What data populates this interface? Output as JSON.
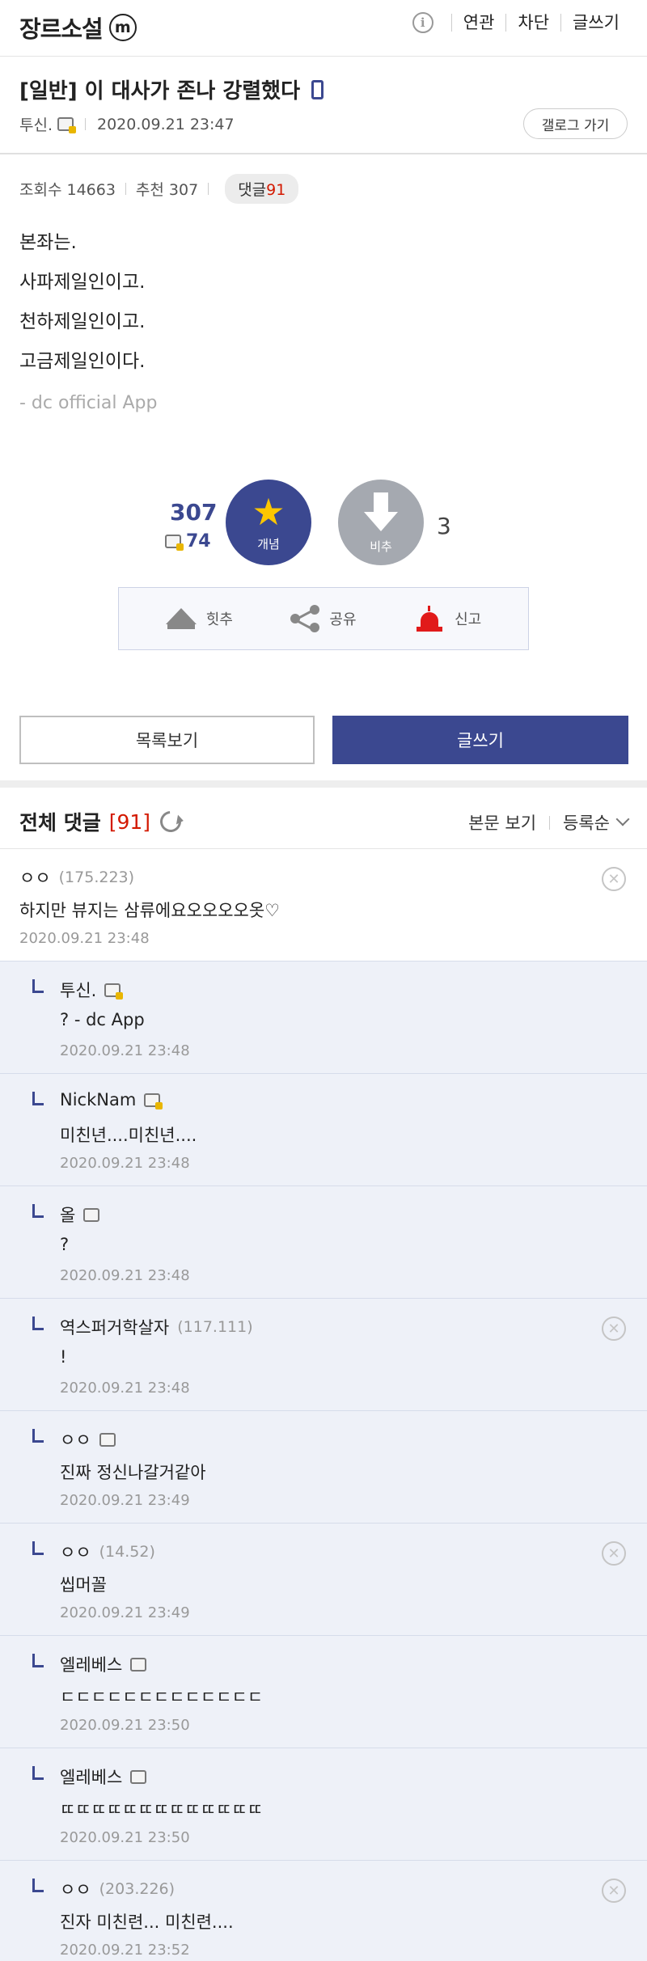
{
  "header": {
    "logo_text": "장르소설",
    "logo_badge": "m",
    "nav": [
      "연관",
      "차단",
      "글쓰기"
    ]
  },
  "post": {
    "title": "[일반] 이 대사가 존나 강렬했다",
    "author": "투신.",
    "datetime": "2020.09.21 23:47",
    "gallog_button": "갤로그 가기",
    "views_label": "조회수 14663",
    "recommend_label": "추천 307",
    "comment_badge_label": "댓글",
    "comment_badge_count": "91",
    "body_lines": [
      "본좌는.",
      "사파제일인이고.",
      "천하제일인이고.",
      "고금제일인이다."
    ],
    "signature": "- dc official App"
  },
  "vote": {
    "up_count": "307",
    "fixed_count": "74",
    "up_label": "개념",
    "down_label": "비추",
    "down_count": "3"
  },
  "actions": [
    "힛추",
    "공유",
    "신고"
  ],
  "buttons": {
    "list": "목록보기",
    "write": "글쓰기"
  },
  "comment_header": {
    "title": "전체 댓글",
    "count": "[91]",
    "view_body": "본문 보기",
    "sort": "등록순"
  },
  "comments": [
    {
      "type": "top",
      "name": "ㅇㅇ",
      "ip": "(175.223)",
      "text": "하지만 뷰지는 삼류에요오오오오옷♡",
      "date": "2020.09.21 23:48",
      "deletable": true,
      "gallog": "none"
    },
    {
      "type": "reply",
      "name": "투신.",
      "ip": "",
      "text": "? - dc App",
      "date": "2020.09.21 23:48",
      "deletable": false,
      "gallog": "fixed"
    },
    {
      "type": "reply",
      "name": "NickNam",
      "ip": "",
      "text": "미친년....미친년....",
      "date": "2020.09.21 23:48",
      "deletable": false,
      "gallog": "fixed"
    },
    {
      "type": "reply",
      "name": "올",
      "ip": "",
      "text": "?",
      "date": "2020.09.21 23:48",
      "deletable": false,
      "gallog": "plain"
    },
    {
      "type": "reply",
      "name": "역스퍼거학살자",
      "ip": "(117.111)",
      "text": "!",
      "date": "2020.09.21 23:48",
      "deletable": true,
      "gallog": "none"
    },
    {
      "type": "reply",
      "name": "ㅇㅇ",
      "ip": "",
      "text": "진짜 정신나갈거같아",
      "date": "2020.09.21 23:49",
      "deletable": false,
      "gallog": "plain"
    },
    {
      "type": "reply",
      "name": "ㅇㅇ",
      "ip": "(14.52)",
      "text": "씹머꼴",
      "date": "2020.09.21 23:49",
      "deletable": true,
      "gallog": "none"
    },
    {
      "type": "reply",
      "name": "엘레베스",
      "ip": "",
      "text": "ㄷㄷㄷㄷㄷㄷㄷㄷㄷㄷㄷㄷㄷ",
      "date": "2020.09.21 23:50",
      "deletable": false,
      "gallog": "plain"
    },
    {
      "type": "reply",
      "name": "엘레베스",
      "ip": "",
      "text": "ㄸㄸㄸㄸㄸㄸㄸㄸㄸㄸㄸㄸㄸ",
      "date": "2020.09.21 23:50",
      "deletable": false,
      "gallog": "plain"
    },
    {
      "type": "reply",
      "name": "ㅇㅇ",
      "ip": "(203.226)",
      "text": "진자 미친련... 미친련....",
      "date": "2020.09.21 23:52",
      "deletable": true,
      "gallog": "none"
    }
  ],
  "colors": {
    "brand_navy": "#3b4890",
    "count_red": "#d31900",
    "star_yellow": "#fdc600",
    "reply_bg": "#eef1f8"
  }
}
